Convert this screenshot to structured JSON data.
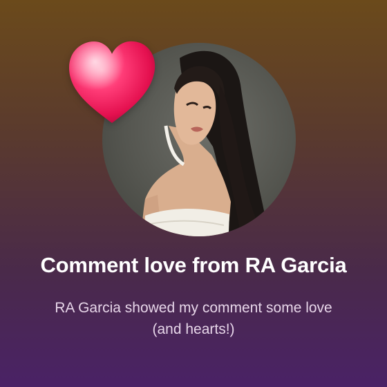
{
  "notification": {
    "title": "Comment love from RA Garcia",
    "message": "RA Garcia showed my comment some love (and hearts!)",
    "icon": "heart-icon",
    "accent_color": "#ff2f6e"
  }
}
